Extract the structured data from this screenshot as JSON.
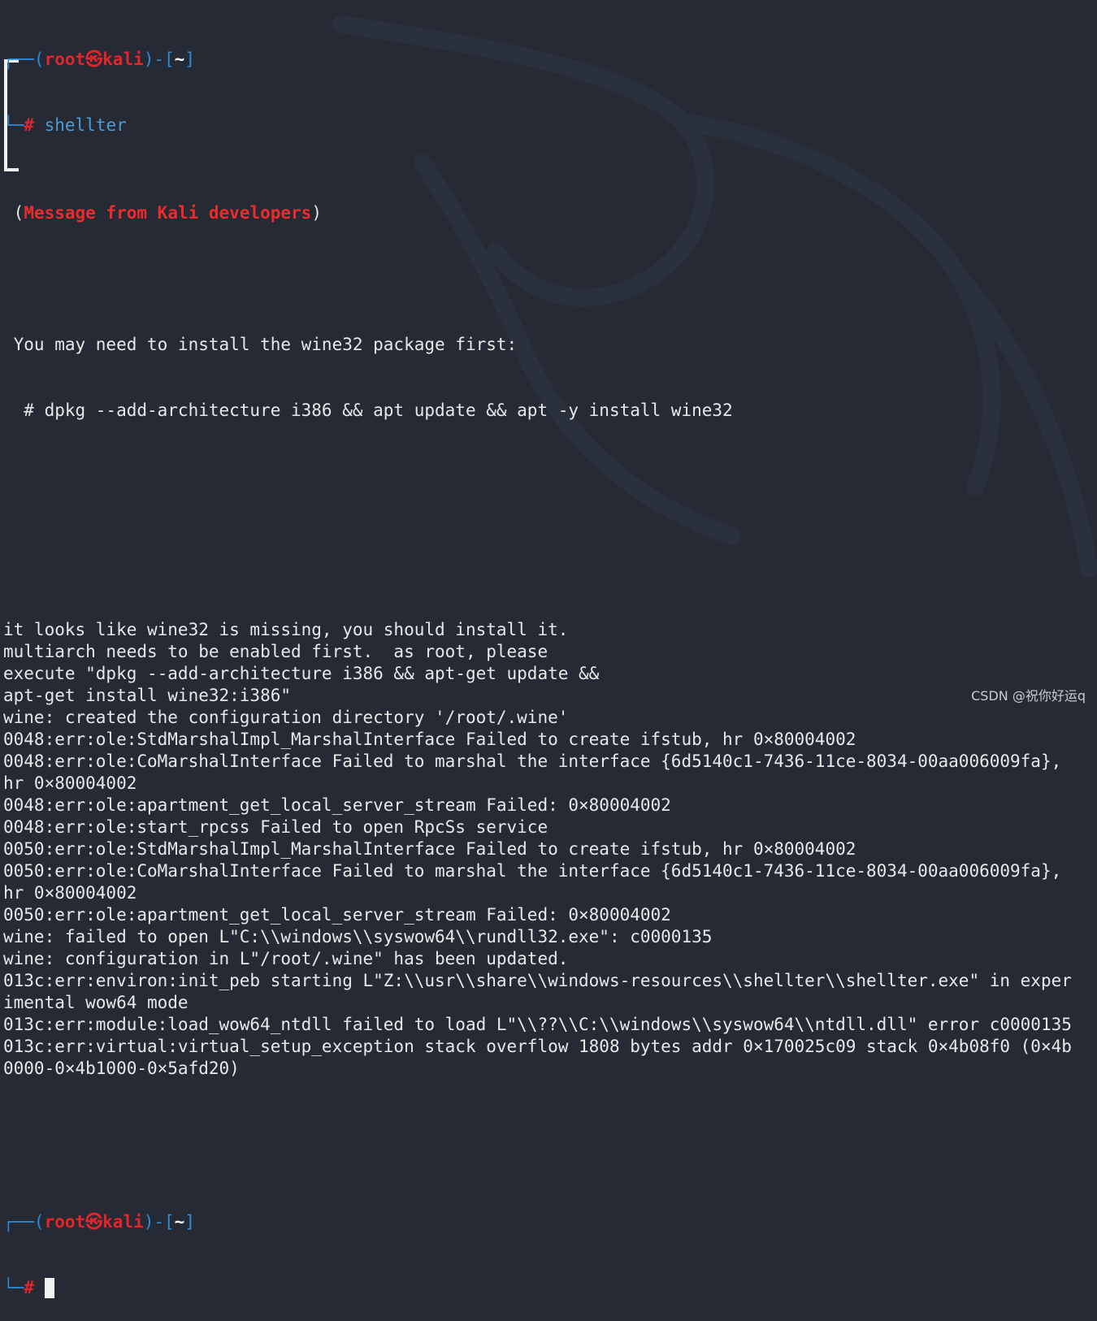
{
  "prompt": {
    "open": "┌──(",
    "user": "root",
    "at": "㉿",
    "host": "kali",
    "path_open": ")-[",
    "path": "~",
    "path_close": "]",
    "line2": "└─",
    "hash": "#"
  },
  "first_command": "shellter",
  "message_box": {
    "paren_open": "(",
    "title": "Message from Kali developers",
    "paren_close": ")",
    "line1": " You may need to install the wine32 package first:",
    "line2": "  # dpkg --add-architecture i386 && apt update && apt -y install wine32"
  },
  "output_lines": [
    "it looks like wine32 is missing, you should install it.",
    "multiarch needs to be enabled first.  as root, please",
    "execute \"dpkg --add-architecture i386 && apt-get update &&",
    "apt-get install wine32:i386\"",
    "wine: created the configuration directory '/root/.wine'",
    "0048:err:ole:StdMarshalImpl_MarshalInterface Failed to create ifstub, hr 0×80004002",
    "0048:err:ole:CoMarshalInterface Failed to marshal the interface {6d5140c1-7436-11ce-8034-00aa006009fa},",
    "hr 0×80004002",
    "0048:err:ole:apartment_get_local_server_stream Failed: 0×80004002",
    "0048:err:ole:start_rpcss Failed to open RpcSs service",
    "0050:err:ole:StdMarshalImpl_MarshalInterface Failed to create ifstub, hr 0×80004002",
    "0050:err:ole:CoMarshalInterface Failed to marshal the interface {6d5140c1-7436-11ce-8034-00aa006009fa},",
    "hr 0×80004002",
    "0050:err:ole:apartment_get_local_server_stream Failed: 0×80004002",
    "wine: failed to open L\"C:\\\\windows\\\\syswow64\\\\rundll32.exe\": c0000135",
    "wine: configuration in L\"/root/.wine\" has been updated.",
    "013c:err:environ:init_peb starting L\"Z:\\\\usr\\\\share\\\\windows-resources\\\\shellter\\\\shellter.exe\" in exper",
    "imental wow64 mode",
    "013c:err:module:load_wow64_ntdll failed to load L\"\\\\??\\\\C:\\\\windows\\\\syswow64\\\\ntdll.dll\" error c0000135",
    "013c:err:virtual:virtual_setup_exception stack overflow 1808 bytes addr 0×170025c09 stack 0×4b08f0 (0×4b",
    "0000-0×4b1000-0×5afd20)"
  ],
  "watermark": "CSDN @祝你好运q",
  "colors": {
    "background": "#252a34",
    "prompt_frame": "#2f8ad8",
    "prompt_user": "#e0262c",
    "command": "#4e9ad6",
    "text": "#e8e8e8"
  }
}
